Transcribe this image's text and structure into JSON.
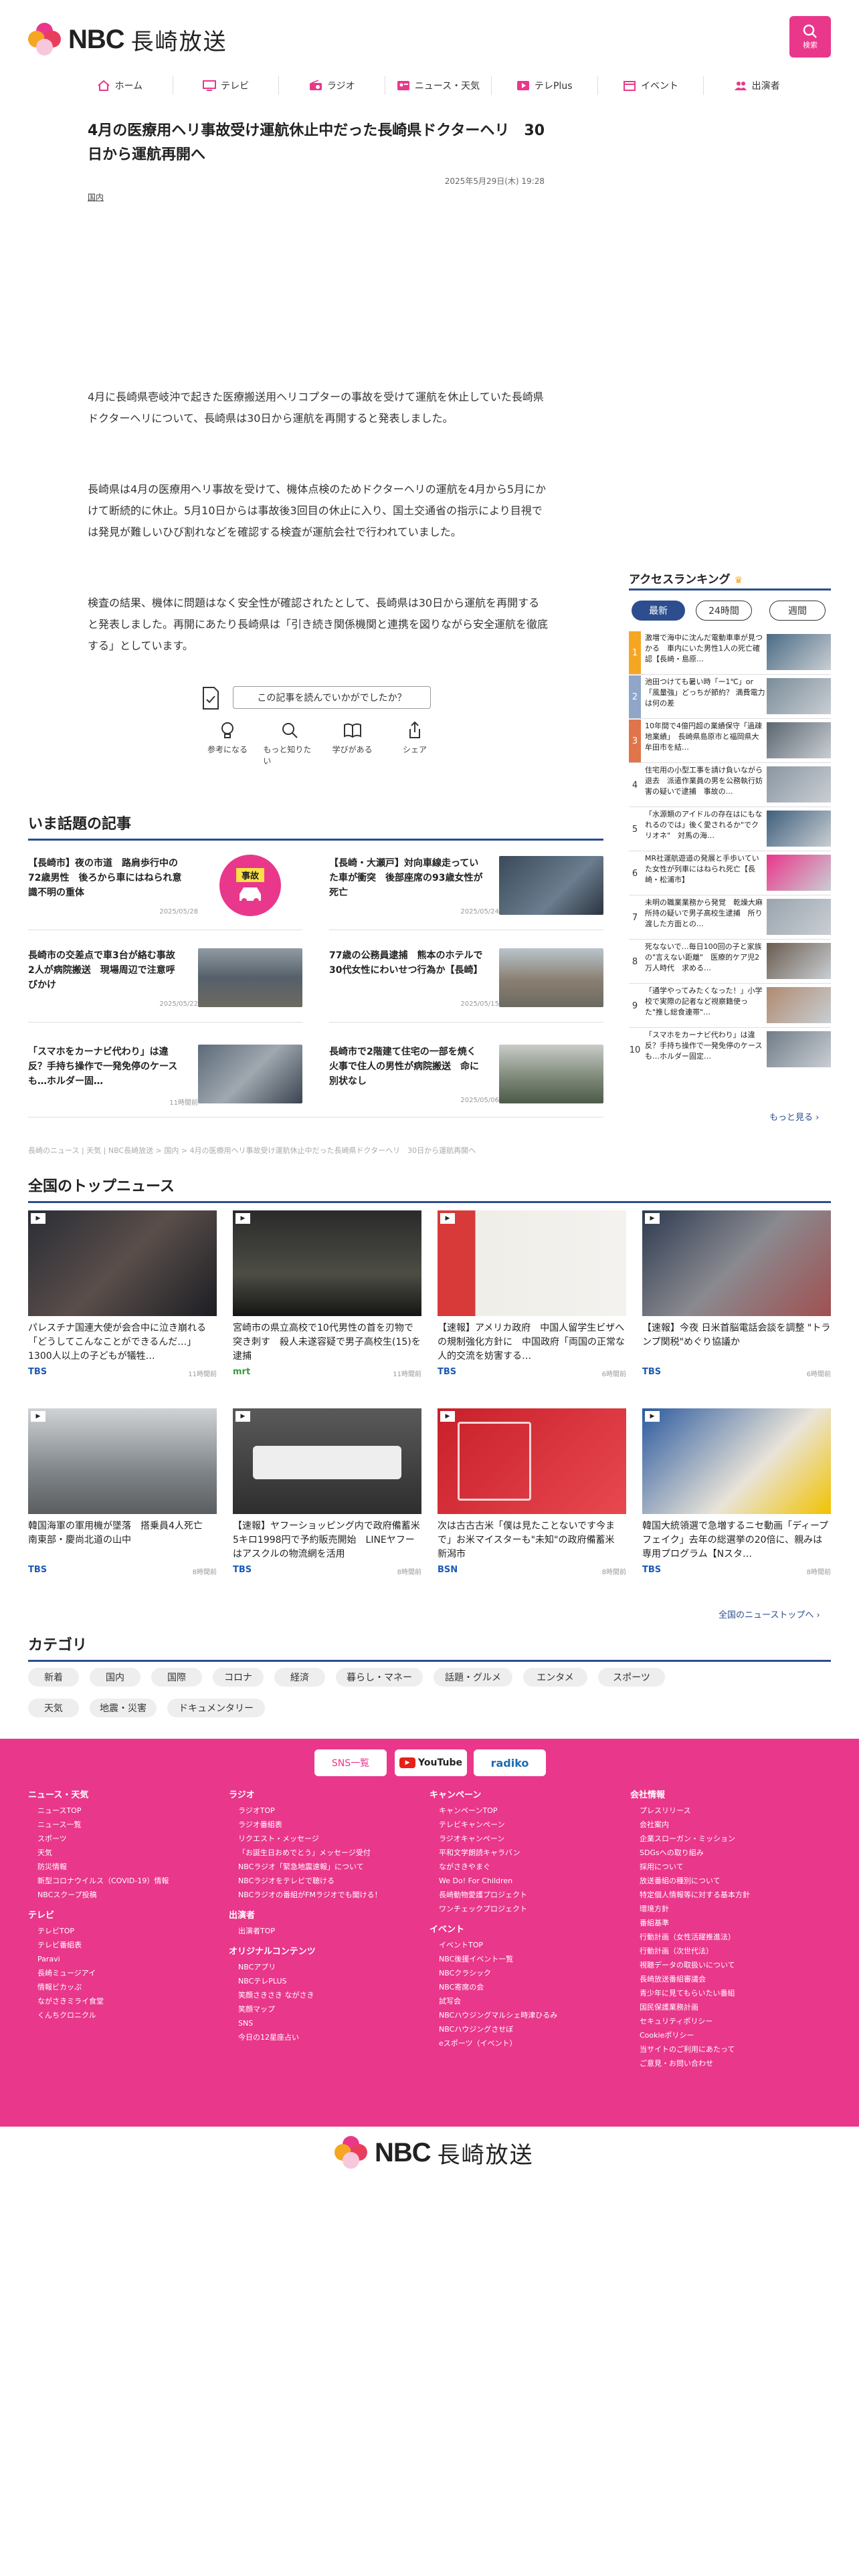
{
  "header": {
    "logo_nbc": "NBC",
    "logo_jp": "長崎放送",
    "search_label": "検索"
  },
  "nav": [
    {
      "label": "ホーム",
      "icon": "home-icon"
    },
    {
      "label": "テレビ",
      "icon": "tv-icon"
    },
    {
      "label": "ラジオ",
      "icon": "radio-icon"
    },
    {
      "label": "ニュース・天気",
      "icon": "news-icon"
    },
    {
      "label": "テレPlus",
      "icon": "play-icon"
    },
    {
      "label": "イベント",
      "icon": "calendar-icon"
    },
    {
      "label": "出演者",
      "icon": "people-icon"
    }
  ],
  "article": {
    "title": "4月の医療用ヘリ事故受け運航休止中だった長崎県ドクターヘリ　30日から運航再開へ",
    "date": "2025年5月29日(木) 19:28",
    "category": "国内",
    "paragraphs": [
      "4月に長崎県壱岐沖で起きた医療搬送用ヘリコプターの事故を受けて運航を休止していた長崎県ドクターヘリについて、長崎県は30日から運航を再開すると発表しました。",
      "長崎県は4月の医療用ヘリ事故を受けて、機体点検のためドクターヘリの運航を4月から5月にかけて断続的に休止。5月10日からは事故後3回目の休止に入り、国土交通省の指示により目視では発見が難しいひび割れなどを確認する検査が運航会社で行われていました。",
      "検査の結果、機体に問題はなく安全性が確認されたとして、長崎県は30日から運航を再開すると発表しました。再開にあたり長崎県は「引き続き関係機関と連携を図りながら安全運航を徹底する」としています。"
    ]
  },
  "feedback": {
    "question": "この記事を読んでいかがでしたか？",
    "buttons": [
      "参考になる",
      "もっと知りたい",
      "学びがある",
      "シェア"
    ]
  },
  "trending": {
    "heading": "いま話題の記事",
    "items": [
      {
        "title": "【長崎市】夜の市道　路肩歩行中の72歳男性　後ろから車にはねられ意識不明の重体",
        "date": "2025/05/28",
        "badge": "事故"
      },
      {
        "title": "【長崎・大瀬戸】対向車線走っていた車が衝突　後部座席の93歳女性が死亡",
        "date": "2025/05/24",
        "badge": ""
      },
      {
        "title": "長崎市の交差点で車3台が絡む事故　2人が病院搬送　現場周辺で注意呼びかけ",
        "date": "2025/05/22",
        "badge": ""
      },
      {
        "title": "77歳の公務員逮捕　熊本のホテルで30代女性にわいせつ行為か【長崎】",
        "date": "2025/05/15",
        "badge": ""
      },
      {
        "title": "「スマホをカーナビ代わり」は違反？手持ち操作で一発免停のケースも…ホルダー固…",
        "date": "11時間前",
        "badge": ""
      },
      {
        "title": "長崎市で2階建て住宅の一部を焼く火事で住人の男性が病院搬送　命に別状なし",
        "date": "2025/05/06",
        "badge": ""
      }
    ]
  },
  "ranking": {
    "heading": "アクセスランキング",
    "tabs": [
      "最新",
      "24時間",
      "週間"
    ],
    "items": [
      {
        "num": "1",
        "text": "激増で海中に沈んだ電動車車が見つかる　車内にいた男性1人の死亡確認【長崎・島原…"
      },
      {
        "num": "2",
        "text": "池田つけても暑い時「ー1℃」or「風量強」どっちが節約？ 満費電力は何の差"
      },
      {
        "num": "3",
        "text": "10年間で4億円超の業績保守「過疎地業績」　長崎県島原市と福岡県大牟田市を結…"
      },
      {
        "num": "4",
        "text": "住宅用の小型工事を請け負いながら退去　派遣作業員の男を公務執行妨害の疑いで逮捕　事故の…"
      },
      {
        "num": "5",
        "text": "「水源類のアイドルの存在はにもなれるのでは」後く愛されるか\"でクリオネ\"　対馬の海…"
      },
      {
        "num": "6",
        "text": "MR社運航遊道の発展と手歩いていた女性が列車にはねられ死亡【長崎・松浦市】"
      },
      {
        "num": "7",
        "text": "未明の職業業務から発覚　乾燥大麻所持の疑いで男子高校生逮捕　所り渡した方面との…"
      },
      {
        "num": "8",
        "text": "死なないで…毎日100回の子と家族の\"言えない距離\"　医療的ケア児2万人時代　求める…"
      },
      {
        "num": "9",
        "text": "「通学やってみたくなった！」小学校で実際の記者など視察籍使った\"推し総食連帯\"…"
      },
      {
        "num": "10",
        "text": "「スマホをカーナビ代わり」は違反？手持ち操作で一発免停のケースも…ホルダー固定…"
      }
    ],
    "more": "もっと見る ›"
  },
  "breadcrumb": "長崎のニュース | 天気 | NBC長崎放送 > 国内 > 4月の医療用ヘリ事故受け運航休止中だった長崎県ドクターヘリ　30日から運航再開へ",
  "national": {
    "heading": "全国のトップニュース",
    "items": [
      {
        "title": "パレスチナ国連大使が会合中に泣き崩れる「どうしてこんなことができるんだ…」1300人以上の子どもが犠牲…",
        "source": "TBS",
        "date": "11時間前"
      },
      {
        "title": "宮崎市の県立高校で10代男性の首を刃物で突き刺す　殺人未遂容疑で男子高校生(15)を逮捕",
        "source": "mrt",
        "date": "11時間前"
      },
      {
        "title": "【速報】アメリカ政府　中国人留学生ビザへの規制強化方針に　中国政府「両国の正常な人的交流を妨害する…",
        "source": "TBS",
        "date": "6時間前"
      },
      {
        "title": "【速報】今夜 日米首脳電話会談を調整 \"トランプ関税\"めぐり協議か",
        "source": "TBS",
        "date": "6時間前"
      },
      {
        "title": "韓国海軍の軍用機が墜落　搭乗員4人死亡　南東部・慶尚北道の山中",
        "source": "TBS",
        "date": "8時間前"
      },
      {
        "title": "【速報】ヤフーショッピング内で政府備蓄米5キロ1998円で予約販売開始　LINEヤフーはアスクルの物流網を活用",
        "source": "TBS",
        "date": "8時間前"
      },
      {
        "title": "次は古古古米「僕は見たことないです今まで」お米マイスターも\"未知\"の政府備蓄米　新潟市",
        "source": "BSN",
        "date": "8時間前"
      },
      {
        "title": "韓国大統領選で急増するニセ動画「ディープフェイク」去年の総選挙の20倍に、親みは専用プログラム【Nスタ…",
        "source": "TBS",
        "date": "8時間前"
      }
    ],
    "more": "全国のニューストップへ ›"
  },
  "category": {
    "heading": "カテゴリ",
    "chips": [
      "新着",
      "国内",
      "国際",
      "コロナ",
      "経済",
      "暮らし・マネー",
      "話題・グルメ",
      "エンタメ",
      "スポーツ",
      "天気",
      "地震・災害",
      "ドキュメンタリー"
    ]
  },
  "footer": {
    "buttons": [
      "SNS一覧",
      "YouTube",
      "radiko"
    ],
    "cols": [
      {
        "heads": [
          {
            "h": "ニュース・天気",
            "items": [
              "ニュースTOP",
              "ニュース一覧",
              "スポーツ",
              "天気",
              "防災情報",
              "新型コロナウイルス（COVID-19）情報",
              "NBCスクープ投稿"
            ]
          },
          {
            "h": "テレビ",
            "items": [
              "テレビTOP",
              "テレビ番組表",
              "Paravi",
              "長崎ミュージアイ",
              "情報ビカッぷ",
              "ながさきミライ食堂",
              "くんちクロニクル"
            ]
          }
        ]
      },
      {
        "heads": [
          {
            "h": "ラジオ",
            "items": [
              "ラジオTOP",
              "ラジオ番組表",
              "リクエスト・メッセージ",
              "「お誕生日おめでとう」メッセージ受付",
              "NBCラジオ「緊急地震速報」について",
              "NBCラジオをテレビで聴ける",
              "NBCラジオの番組がFMラジオでも聞ける！"
            ]
          },
          {
            "h": "出演者",
            "items": [
              "出演者TOP"
            ]
          },
          {
            "h": "オリジナルコンテンツ",
            "items": [
              "NBCアプリ",
              "NBCテレPLUS",
              "笑顔さきさき ながさき",
              "笑顔マップ",
              "SNS",
              "今日の12星座占い"
            ]
          }
        ]
      },
      {
        "heads": [
          {
            "h": "キャンペーン",
            "items": [
              "キャンペーンTOP",
              "テレビキャンペーン",
              "ラジオキャンペーン",
              "平和文学朗読キャラバン",
              "ながさきやまぐ",
              "We Do! For Children",
              "長崎動物愛護プロジェクト",
              "ワンチェックプロジェクト"
            ]
          },
          {
            "h": "イベント",
            "items": [
              "イベントTOP",
              "NBC後援イベント一覧",
              "NBCクラシック",
              "NBC寄席の会",
              "試写会",
              "NBCハウジングマルシェ時津ひるみ",
              "NBCハウジングさせぼ",
              "eスポーツ（イベント）"
            ]
          }
        ]
      },
      {
        "heads": [
          {
            "h": "会社情報",
            "items": [
              "プレスリリース",
              "会社案内",
              "企業スローガン・ミッション",
              "SDGsへの取り組み",
              "採用について",
              "放送番組の種別について",
              "特定個人情報等に対する基本方針",
              "環境方針",
              "番組基準",
              "行動計画（女性活躍推進法）",
              "行動計画（次世代法）",
              "視聴データの取扱いについて",
              "長崎放送番組審議会",
              "青少年に見てもらいたい番組",
              "国民保護業務計画",
              "セキュリティポリシー",
              "Cookieポリシー",
              "当サイトのご利用にあたって",
              "ご意見・お問い合わせ"
            ]
          }
        ]
      }
    ]
  },
  "colors": {
    "accent": "#e9378b",
    "navy": "#2c4d8e"
  }
}
